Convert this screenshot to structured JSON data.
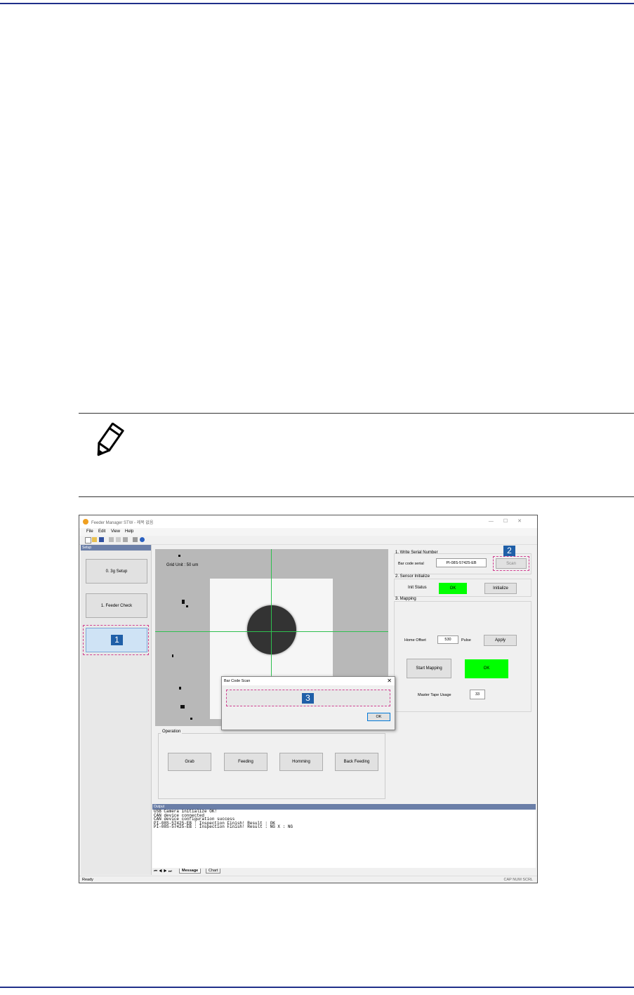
{
  "screenshot": {
    "window_title": "Feeder Manager STW - 제목 없음",
    "window_controls": [
      "—",
      "☐",
      "✕"
    ],
    "menu": [
      "File",
      "Edit",
      "View",
      "Help"
    ],
    "setup_pane_title": "Setup",
    "setup_buttons": [
      "0. 3g Setup",
      "1. Feeder Check"
    ],
    "grid_unit": "Grid Unit : 50 um",
    "operation": {
      "title": "Operation",
      "buttons": [
        "Grab",
        "Feeding",
        "Homming",
        "Back Feeding"
      ]
    },
    "write_serial": {
      "title": "1. Write Serial Number",
      "label": "Bar code serial",
      "value": "PI-08S-57425-EB",
      "scan_button": "Scan"
    },
    "sensor": {
      "title": "2. Sensor Initialize",
      "label": "Init Status",
      "status": "OK",
      "button": "Initialize"
    },
    "mapping": {
      "title": "3. Mapping",
      "offset_label": "Home Offset",
      "offset_value": "530",
      "unit": "Pulse",
      "apply_button": "Apply",
      "start_button": "Start Mapping",
      "status": "OK",
      "usage_label": "Master Tape Usage",
      "usage_value": "33"
    },
    "dialog": {
      "title": "Bar Code Scan",
      "close": "✕",
      "ok_button": "OK"
    },
    "output": {
      "title": "Output",
      "lines": [
        "USB Camera initialize OK!",
        "CAN device connected",
        "CAN device configuration success",
        "PI-08S-57425-EB : Inspection Finish!   Result : OK",
        "PI-08S-57425-EB : Inspection Finish!   Result : NG    X : NG"
      ]
    },
    "tabs": [
      "Message",
      "Chart"
    ],
    "status_left": "Ready",
    "status_right": "CAP  NUM  SCRL"
  },
  "callouts": [
    "1",
    "2",
    "3"
  ],
  "colors": {
    "accent": "#1f2f8a",
    "callout": "#1f5fa8",
    "status_ok": "#00ff00",
    "dashed": "#d04090"
  },
  "icons": [
    "pencil-note-icon",
    "app-icon",
    "new-file-icon",
    "open-folder-icon",
    "save-icon",
    "cut-icon",
    "copy-icon",
    "paste-icon",
    "print-icon",
    "help-icon"
  ]
}
